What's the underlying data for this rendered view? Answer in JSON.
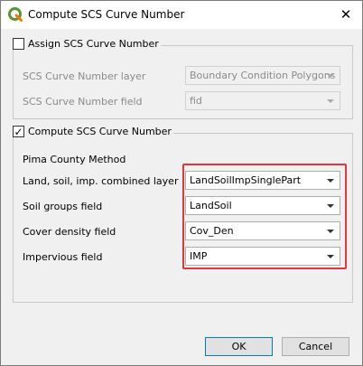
{
  "window": {
    "title": "Compute SCS Curve Number",
    "icon": "qgis-logo-icon",
    "close_glyph": "✕"
  },
  "assign_group": {
    "checkbox_label": "Assign SCS Curve Number",
    "checked": false,
    "rows": [
      {
        "label": "SCS Curve Number layer",
        "value": "Boundary Condition Polygons"
      },
      {
        "label": "SCS Curve Number field",
        "value": "fid"
      }
    ]
  },
  "compute_group": {
    "checkbox_label": "Compute SCS Curve Number",
    "checked": true,
    "check_glyph": "✓",
    "section_label": "Pima County Method",
    "rows": [
      {
        "label": "Land, soil, imp. combined layer",
        "value": "LandSoilImpSinglePart"
      },
      {
        "label": "Soil groups field",
        "value": "LandSoil"
      },
      {
        "label": "Cover density field",
        "value": "Cov_Den"
      },
      {
        "label": "Impervious field",
        "value": "IMP"
      }
    ]
  },
  "buttons": {
    "ok": "OK",
    "cancel": "Cancel"
  },
  "colors": {
    "highlight": "#e0363c",
    "qgis_green": "#589632",
    "qgis_yellow": "#ee7913"
  }
}
